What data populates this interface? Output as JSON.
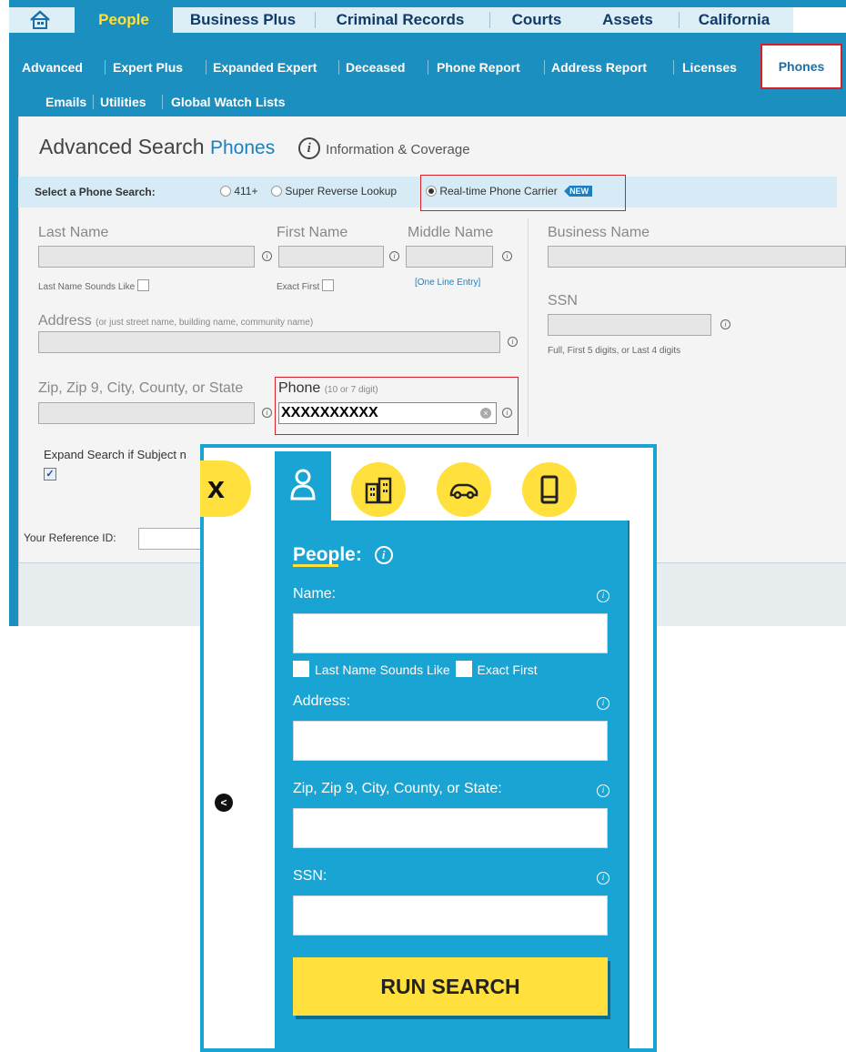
{
  "top_tabs": [
    "People",
    "Business Plus",
    "Criminal Records",
    "Courts",
    "Assets",
    "California"
  ],
  "subnav_row1": [
    "Advanced",
    "Expert Plus",
    "Expanded Expert",
    "Deceased",
    "Phone Report",
    "Address Report",
    "Licenses"
  ],
  "subnav_active": "Phones",
  "subnav_row2": [
    "Emails",
    "Utilities",
    "Global Watch Lists"
  ],
  "heading": {
    "title": "Advanced Search",
    "subtitle": "Phones",
    "info_icon": "i",
    "info_text": "Information & Coverage"
  },
  "search_type": {
    "label": "Select a Phone Search:",
    "options": [
      "411+",
      "Super Reverse Lookup",
      "Real-time Phone Carrier"
    ],
    "selected": "Real-time Phone Carrier",
    "badge": "NEW"
  },
  "form": {
    "last_name": "Last Name",
    "first_name": "First Name",
    "middle_name": "Middle Name",
    "business_name": "Business Name",
    "last_name_sounds_like": "Last Name Sounds Like",
    "exact_first": "Exact First",
    "one_line_entry": "[One Line Entry]",
    "ssn": "SSN",
    "ssn_help": "Full, First 5 digits, or Last 4 digits",
    "address": "Address",
    "address_hint": "(or just street name, building name, community name)",
    "zip": "Zip, Zip 9, City, County, or State",
    "phone": "Phone",
    "phone_hint": "(10 or 7 digit)",
    "phone_value": "XXXXXXXXXX",
    "expand_search": "Expand Search if Subject n",
    "reference_id": "Your Reference ID:"
  },
  "overlay": {
    "close_icon": "x",
    "heading": "People:",
    "name_label": "Name:",
    "last_name_sounds_like": "Last Name Sounds Like",
    "exact_first": "Exact First",
    "address_label": "Address:",
    "zip_label": "Zip, Zip 9, City, County, or State:",
    "ssn_label": "SSN:",
    "run_button": "RUN SEARCH",
    "info_icon": "i",
    "back_icon": "<"
  },
  "colors": {
    "brand_blue": "#1b8fbf",
    "accent_yellow": "#ffe03d",
    "highlight_red": "#d81f26"
  }
}
